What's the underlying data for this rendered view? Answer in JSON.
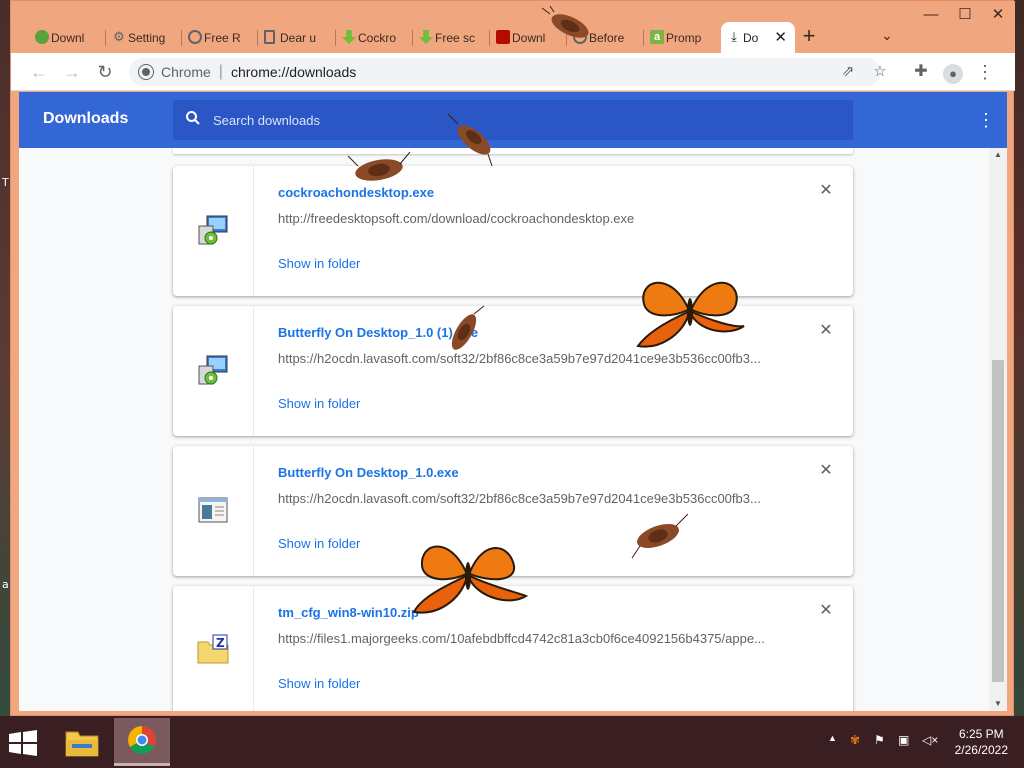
{
  "desktop": {
    "edge_text_top": "T",
    "edge_text_mid": "a"
  },
  "tabs": [
    {
      "label": "Downl",
      "icon": "downloads-site-icon",
      "color": "#5aa33a"
    },
    {
      "label": "Setting",
      "icon": "gear-icon",
      "color": "#5f6368"
    },
    {
      "label": "Free R",
      "icon": "globe-icon",
      "color": "#5f6368"
    },
    {
      "label": "Dear u",
      "icon": "document-icon",
      "color": "#5f6368"
    },
    {
      "label": "Cockro",
      "icon": "download-arrow-icon",
      "color": "#6fbf3a"
    },
    {
      "label": "Free sc",
      "icon": "download-arrow-icon",
      "color": "#6fbf3a"
    },
    {
      "label": "Downl",
      "icon": "adobe-icon",
      "color": "#b30b00"
    },
    {
      "label": "Before",
      "icon": "globe-icon",
      "color": "#5f6368"
    },
    {
      "label": "Promp",
      "icon": "amazon-icon",
      "color": "#7cb342"
    },
    {
      "label": "Do",
      "icon": "download-icon",
      "color": "#202124",
      "active": true
    }
  ],
  "address": {
    "site_label": "Chrome",
    "url": "chrome://downloads"
  },
  "header": {
    "title": "Downloads",
    "search_placeholder": "Search downloads"
  },
  "downloads": [
    {
      "name": "cockroachondesktop.exe",
      "url": "http://freedesktopsoft.com/download/cockroachondesktop.exe",
      "action": "Show in folder",
      "icon": "installer-icon"
    },
    {
      "name": "Butterfly On Desktop_1.0 (1).exe",
      "url": "https://h2ocdn.lavasoft.com/soft32/2bf86c8ce3a59b7e97d2041ce9e3b536cc00fb3...",
      "action": "Show in folder",
      "icon": "installer-icon"
    },
    {
      "name": "Butterfly On Desktop_1.0.exe",
      "url": "https://h2ocdn.lavasoft.com/soft32/2bf86c8ce3a59b7e97d2041ce9e3b536cc00fb3...",
      "action": "Show in folder",
      "icon": "window-app-icon"
    },
    {
      "name": "tm_cfg_win8-win10.zip",
      "url": "https://files1.majorgeeks.com/10afebdbffcd4742c81a3cb0f6ce4092156b4375/appe...",
      "action": "Show in folder",
      "icon": "zip-folder-icon"
    }
  ],
  "taskbar": {
    "time": "6:25 PM",
    "date": "2/26/2022"
  },
  "colors": {
    "accent": "#3367d6",
    "link": "#1a73e8",
    "tab_strip": "#f0a77f"
  }
}
